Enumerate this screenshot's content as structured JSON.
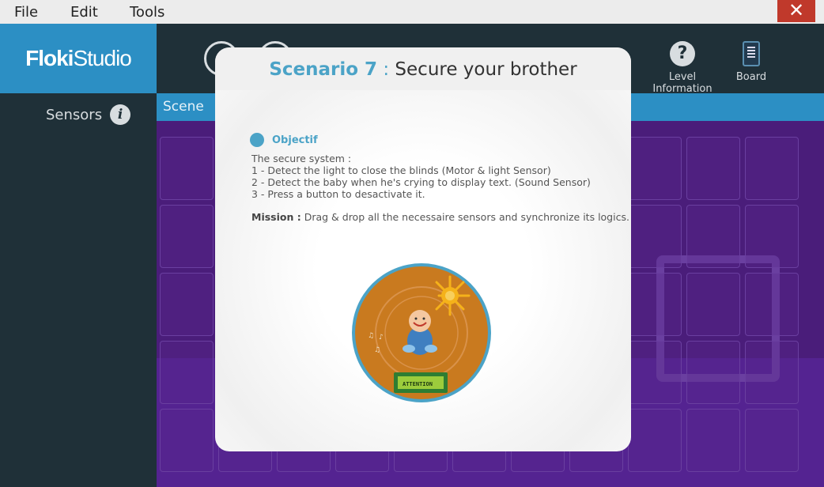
{
  "menu": {
    "file": "File",
    "edit": "Edit",
    "tools": "Tools",
    "close": "✕"
  },
  "logo": {
    "bold": "Floki",
    "light": "Studio"
  },
  "sidebar": {
    "sensors_label": "Sensors",
    "info": "i"
  },
  "toolbar": {
    "level_info_icon": "?",
    "level_info_label": "Level Information",
    "board_label": "Board"
  },
  "scene": {
    "tab_label": "Scene"
  },
  "modal": {
    "scenario_num": "Scenario 7",
    "separator": " : ",
    "scenario_title": "Secure your brother",
    "objectif_label": "Objectif",
    "desc_lines": [
      "The secure system :",
      "1 - Detect the light to close the blinds (Motor & light Sensor)",
      "2 - Detect the baby when he's crying to display text. (Sound Sensor)",
      "3 - Press a button to desactivate it."
    ],
    "mission_label": "Mission :",
    "mission_text": " Drag & drop all the necessaire sensors and synchronize its logics.",
    "lcd_text": "ATTENTION"
  },
  "colors": {
    "accent": "#4ba3c7",
    "logo_bg": "#2c8fc4",
    "close_bg": "#c0392b",
    "scene_bg": "#4a1d7a"
  }
}
